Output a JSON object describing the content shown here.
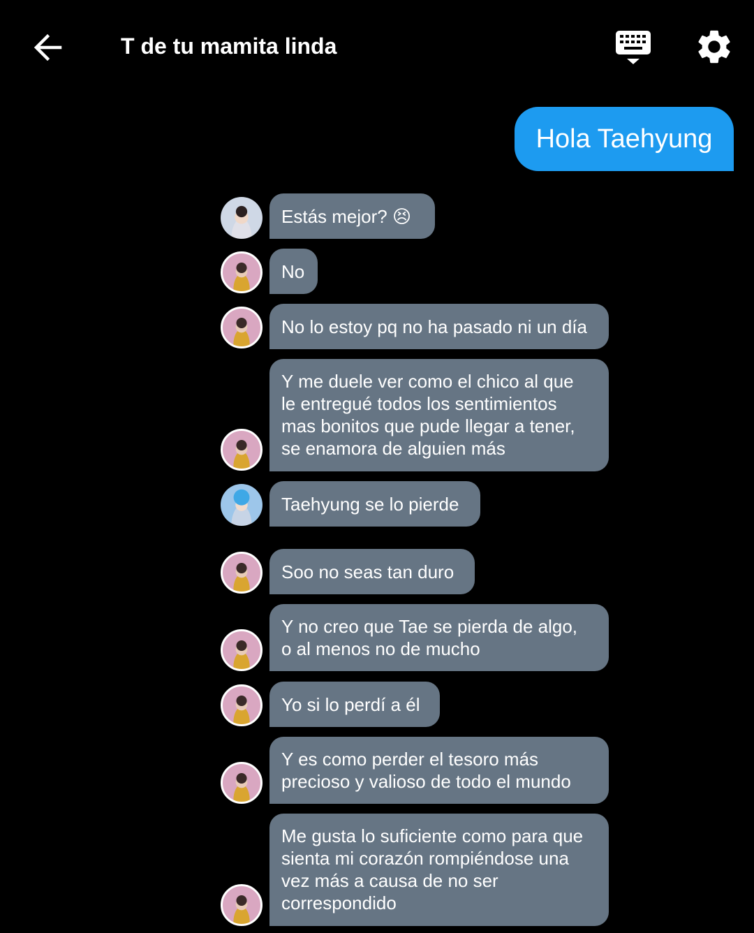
{
  "header": {
    "title": "T de tu mamita linda"
  },
  "colors": {
    "background": "#000000",
    "sent_bubble": "#1d9bf0",
    "received_bubble": "#667584"
  },
  "messages": {
    "sent": [
      {
        "text": "Hola Taehyung"
      }
    ],
    "received": [
      {
        "text": "Estás mejor? 😣",
        "avatar": "profile-photo"
      },
      {
        "text": "No",
        "avatar": "profile-photo"
      },
      {
        "text": "No lo estoy pq no ha pasado ni un día",
        "avatar": "profile-photo"
      },
      {
        "text": "Y me duele ver como el chico al que\nle entregué todos los sentimientos\nmas bonitos que pude llegar a tener,\nse enamora de alguien más",
        "avatar": "profile-photo"
      },
      {
        "text": "Taehyung se lo pierde",
        "avatar": "profile-photo"
      },
      {
        "text": "Soo no seas tan duro",
        "avatar": "profile-photo"
      },
      {
        "text": "Y no creo que Tae se pierda de algo,\no al menos no de mucho",
        "avatar": "profile-photo"
      },
      {
        "text": "Yo si lo perdí a él",
        "avatar": "profile-photo"
      },
      {
        "text": "Y es como perder el tesoro más\nprecioso y valioso de todo el mundo",
        "avatar": "profile-photo"
      },
      {
        "text": "Me gusta lo suficiente como para que\nsienta mi corazón rompiéndose una\nvez más a causa de no ser\ncorrespondido",
        "avatar": "profile-photo"
      }
    ]
  }
}
